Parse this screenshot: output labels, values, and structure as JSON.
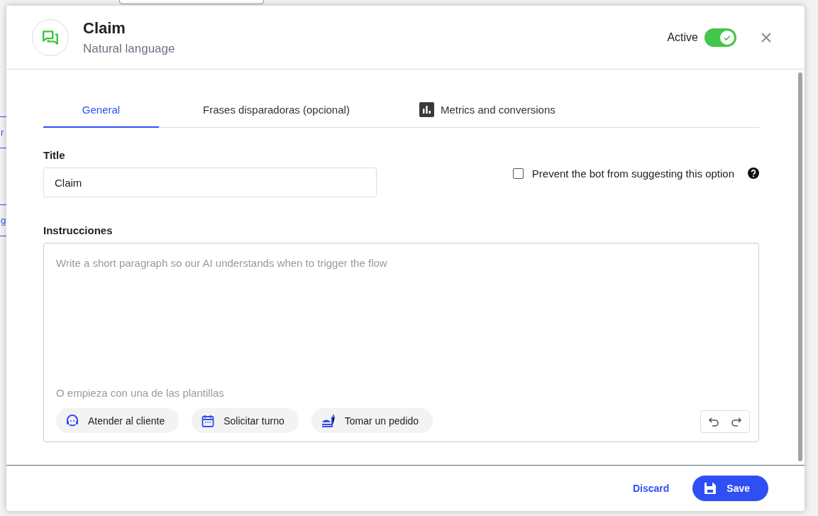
{
  "background": {
    "fragments": [
      "r",
      "g"
    ]
  },
  "header": {
    "title": "Claim",
    "subtitle": "Natural language",
    "active_label": "Active",
    "active": true
  },
  "tabs": [
    {
      "label": "General",
      "selected": true,
      "kind": "plain"
    },
    {
      "label": "Frases disparadoras (opcional)",
      "selected": false,
      "kind": "plain"
    },
    {
      "label": "Metrics and conversions",
      "selected": false,
      "kind": "chart"
    }
  ],
  "title_field": {
    "label": "Title",
    "value": "Claim"
  },
  "prevent_option": {
    "label": "Prevent the bot from suggesting this option",
    "checked": false
  },
  "instructions": {
    "label": "Instrucciones",
    "placeholder": "Write a short paragraph so our AI understands when to trigger the flow",
    "templates_label": "O empieza con una de las plantillas",
    "templates": [
      {
        "label": "Atender al cliente",
        "kind": "support"
      },
      {
        "label": "Solicitar turno",
        "kind": "calendar"
      },
      {
        "label": "Tomar un pedido",
        "kind": "order"
      }
    ]
  },
  "footer": {
    "discard": "Discard",
    "save": "Save"
  }
}
